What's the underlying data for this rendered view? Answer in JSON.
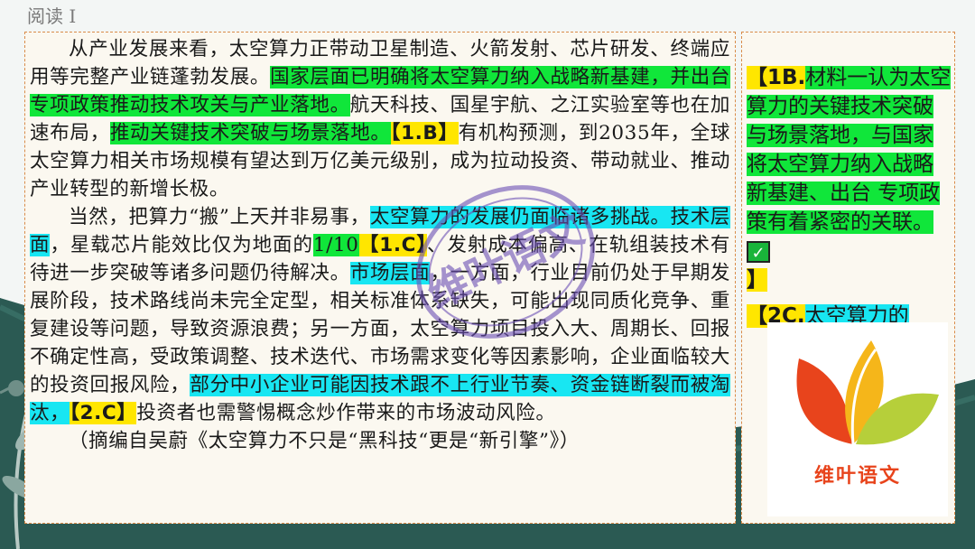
{
  "slide": {
    "title": "阅读 I"
  },
  "main": {
    "p1": {
      "t1": "从产业发展来看，太空算力正带动卫星制造、火箭发射、芯片研发、终端应用等完整产业链蓬勃发展。",
      "h1": "国家层面已明确将太空算力纳入战略新基建，并出台专项政策推动技术攻关与产业落地。",
      "t2": "航天科技、国星宇航、之江实验室等也在加速布局，",
      "h2": "推动关键技术突破与场景落地。",
      "tag": "【1.B】",
      "t3": "有机构预测，到2035年，全球太空算力相关市场规模有望达到万亿美元级别，成为拉动投资、带动就业、推动产业转型的新增长极。"
    },
    "p2": {
      "t1": "当然，把算力“搬”上天并非易事，",
      "h1": "太空算力的发展仍面临诸多挑战。技术层面",
      "t2": "，星载芯片能效比仅为地面的",
      "num": "1/10",
      "tag1": "【1.C】",
      "t3": "、发射成本偏高、在轨组装技术有待进一步突破等诸多问题仍待解决。",
      "h2": "市场层面",
      "t4": "，一方面，行业目前仍处于早期发展阶段，技术路线尚未完全定型，相关标准体系缺失，可能出现同质化竞争、重复建设等问题，导致资源浪费；另一方面，太空算力项目投入大、周期长、回报不确定性高，受政策调整、技术迭代、市场需求变化等因素影响，企业面临较大的投资回报风险，",
      "h3": "部分中小企业可能因技术跟不上行业节奏、资金链断裂而被淘汰，",
      "tag2": "【2.C】",
      "t5": "投资者也需警惕概念炒作带来的市场波动风险。"
    },
    "source": "（摘编自吴蔚《太空算力不只是“黑科技“更是“新引擎”》）"
  },
  "side": {
    "note1_tag": "【1B.",
    "note1_text": "材料一认为太空算力的关键技术突破与场景落地，与国家将太空算力纳入战略新基建、出台 专项政策有着紧密的关联。",
    "note1_end": "】",
    "note2_tag": "【2C.",
    "note2_text": "太空算力的"
  },
  "logo": {
    "text": "维叶语文"
  },
  "watermark": {
    "text": "维叶语文"
  },
  "colors": {
    "green_highlight": "#10e63a",
    "cyan_highlight": "#18e6f2",
    "yellow_tag": "#ffe600",
    "background": "#2f5e57"
  }
}
